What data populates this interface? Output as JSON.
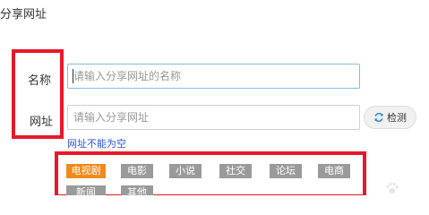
{
  "dialog": {
    "title": "分享网址"
  },
  "form": {
    "name_label": "名称",
    "name_placeholder": "请输入分享网址的名称",
    "url_label": "网址",
    "url_placeholder": "请输入分享网址",
    "check_button_label": "检测",
    "check_icon": "refresh-icon",
    "error_message": "网址不能为空"
  },
  "tags": [
    {
      "label": "电视剧",
      "active": true
    },
    {
      "label": "电影",
      "active": false
    },
    {
      "label": "小说",
      "active": false
    },
    {
      "label": "社交",
      "active": false
    },
    {
      "label": "论坛",
      "active": false
    },
    {
      "label": "电商",
      "active": false
    },
    {
      "label": "新闻",
      "active": false
    },
    {
      "label": "其他",
      "active": false
    }
  ],
  "colors": {
    "highlight_border": "#e8182b",
    "active_tag": "#f08a1c",
    "inactive_tag": "#9a9a9a",
    "error_text": "#2a55d8",
    "focus_border": "#7fbde8",
    "refresh_icon": "#2f8ad8"
  }
}
